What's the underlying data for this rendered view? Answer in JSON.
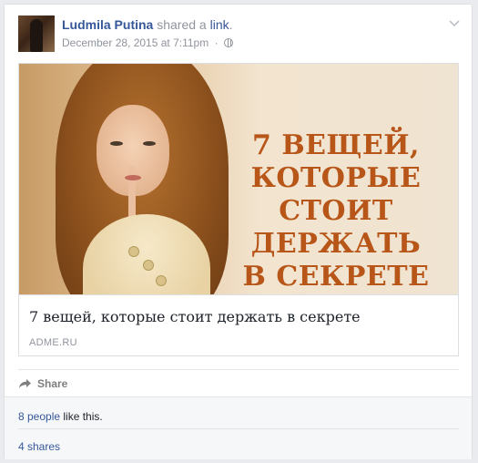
{
  "post": {
    "author": "Ludmila Putina",
    "action_prefix": "shared a",
    "action_link": "link",
    "action_suffix": ".",
    "date": "December 28, 2015 at 7:11pm",
    "separator": "·",
    "privacy_icon": "globe-icon",
    "menu_icon": "chevron-down-icon"
  },
  "link_preview": {
    "headline_lines": [
      "7 ВЕЩЕЙ, КОТОРЫЕ",
      "СТОИТ ДЕРЖАТЬ",
      "В СЕКРЕТЕ"
    ],
    "title": "7 вещей, которые стоит держать в секрете",
    "domain": "ADME.RU",
    "headline_color": "#b75618"
  },
  "actions": {
    "share_label": "Share",
    "share_icon": "share-arrow-icon"
  },
  "footer": {
    "likes_people": "8 people",
    "likes_suffix": " like this.",
    "shares": "4 shares"
  },
  "colors": {
    "link_blue": "#365899",
    "meta_gray": "#90949c",
    "background": "#e9ebee"
  }
}
